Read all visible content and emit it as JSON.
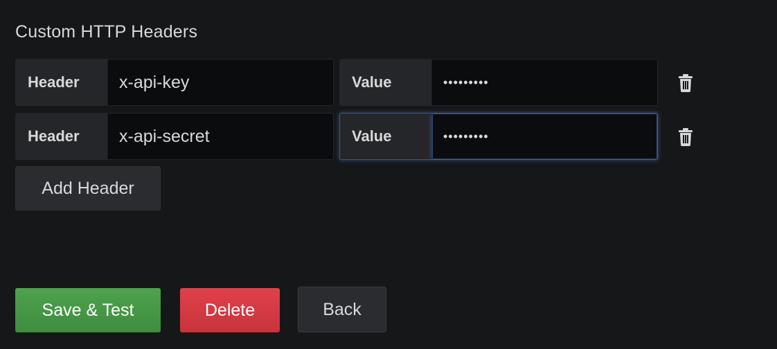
{
  "section": {
    "title": "Custom HTTP Headers"
  },
  "headers": [
    {
      "key_label": "Header",
      "key_value": "x-api-key",
      "value_label": "Value",
      "value_value": "•••••••••",
      "focused": false
    },
    {
      "key_label": "Header",
      "key_value": "x-api-secret",
      "value_label": "Value",
      "value_value": "•••••••••",
      "focused": true
    }
  ],
  "actions": {
    "add_header": "Add Header",
    "save_test": "Save & Test",
    "delete": "Delete",
    "back": "Back"
  },
  "icons": {
    "delete_row": "trash-icon"
  },
  "colors": {
    "background": "#161719",
    "label_bg": "#252629",
    "input_bg": "#0b0c0e",
    "save": "#449a44",
    "delete": "#d5383f",
    "focus_ring": "#4e78be"
  }
}
